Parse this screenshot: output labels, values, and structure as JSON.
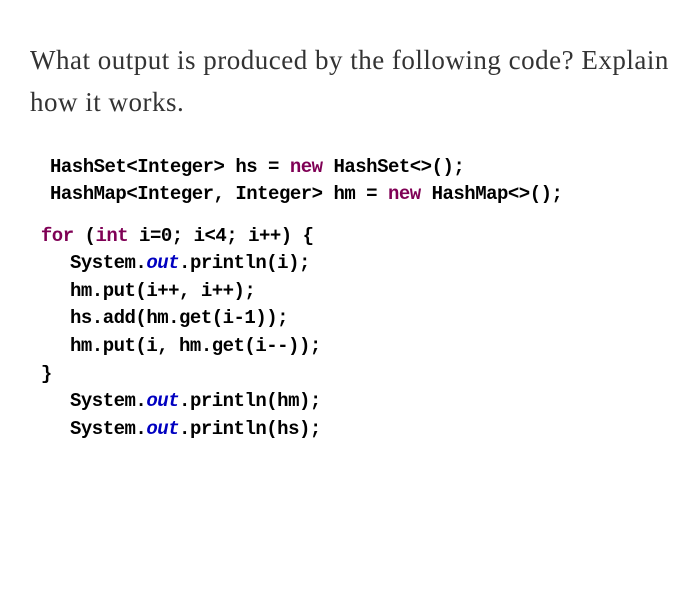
{
  "question": "What output is produced by the following code? Explain how it works.",
  "code": {
    "line1_p1": "HashSet<Integer> hs = ",
    "line1_kw": "new",
    "line1_p2": " HashSet<>();",
    "line2_p1": "HashMap<Integer, Integer> hm = ",
    "line2_kw": "new",
    "line2_p2": " HashMap<>();",
    "line3_kw1": "for",
    "line3_p1": " (",
    "line3_kw2": "int",
    "line3_p2": " i=0; i<4; i++) {",
    "line4_p1": "System.",
    "line4_out": "out",
    "line4_p2": ".println(i);",
    "line5": "hm.put(i++, i++);",
    "line6": "hs.add(hm.get(i-1));",
    "line7": "hm.put(i, hm.get(i--));",
    "line8": "}",
    "line9_p1": "System.",
    "line9_out": "out",
    "line9_p2": ".println(hm);",
    "line10_p1": "System.",
    "line10_out": "out",
    "line10_p2": ".println(hs);"
  }
}
